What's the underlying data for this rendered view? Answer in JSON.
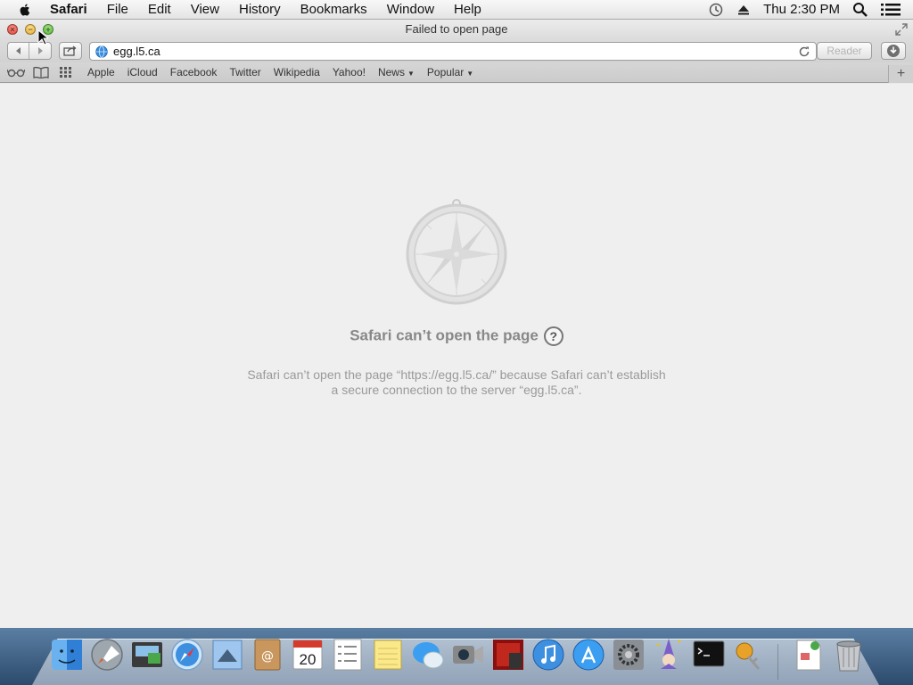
{
  "menubar": {
    "app": "Safari",
    "items": [
      "File",
      "Edit",
      "View",
      "History",
      "Bookmarks",
      "Window",
      "Help"
    ],
    "clock": "Thu 2:30 PM"
  },
  "window": {
    "title": "Failed to open page"
  },
  "toolbar": {
    "url": "egg.l5.ca",
    "reader_label": "Reader"
  },
  "bookmarks": {
    "items": [
      "Apple",
      "iCloud",
      "Facebook",
      "Twitter",
      "Wikipedia",
      "Yahoo!",
      "News",
      "Popular"
    ]
  },
  "newtab": "+",
  "error": {
    "title": "Safari can’t open the page",
    "help": "?",
    "line1": "Safari can’t open the page “https://egg.l5.ca/” because Safari can’t establish",
    "line2": "a secure connection to the server “egg.l5.ca”."
  },
  "dock": {
    "calendar_day": "20",
    "icons": [
      "finder-icon",
      "launchpad-icon",
      "image-capture-icon",
      "safari-icon",
      "mail-icon",
      "contacts-icon",
      "calendar-icon",
      "reminders-icon",
      "notes-icon",
      "messages-icon",
      "facetime-icon",
      "photo-booth-icon",
      "itunes-icon",
      "app-store-icon",
      "system-preferences-icon",
      "wizard-icon",
      "terminal-icon",
      "keychain-icon",
      "preview-icon",
      "trash-icon"
    ]
  },
  "colors": {
    "close": "#e0443a",
    "minimize": "#e5a82c",
    "zoom": "#4eb22e"
  }
}
